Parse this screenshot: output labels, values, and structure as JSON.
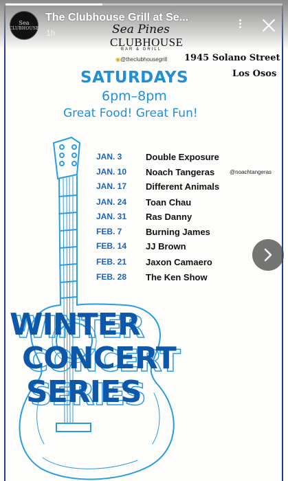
{
  "story": {
    "account_name": "The Clubhouse Grill at Se...",
    "time_ago": "1h",
    "progress": 0.35,
    "avatar_text_top": "Sea",
    "avatar_text": "CLUBHOUSE"
  },
  "flyer": {
    "brand_script": "Sea Pines",
    "brand_name": "CLUBHOUSE",
    "brand_sub": "BAR & GRILL",
    "instagram_handle": "@theclubhousegrill",
    "address_line1": "1945 Solano Street",
    "address_line2": "Los Osos",
    "day": "SATURDAYS",
    "time": "6pm–8pm",
    "tagline": "Great Food! Great Fun!",
    "schedule": [
      {
        "date": "JAN. 3",
        "act": "Double Exposure",
        "tag": ""
      },
      {
        "date": "JAN. 10",
        "act": "Noach Tangeras",
        "tag": "@noachtangeras"
      },
      {
        "date": "JAN. 17",
        "act": "Different Animals",
        "tag": ""
      },
      {
        "date": "JAN. 24",
        "act": "Toan Chau",
        "tag": ""
      },
      {
        "date": "JAN. 31",
        "act": "Ras Danny",
        "tag": ""
      },
      {
        "date": "FEB. 7",
        "act": "Burning James",
        "tag": ""
      },
      {
        "date": "FEB. 14",
        "act": "JJ Brown",
        "tag": ""
      },
      {
        "date": "FEB. 21",
        "act": "Jaxon Camaero",
        "tag": ""
      },
      {
        "date": "FEB. 28",
        "act": "The Ken Show",
        "tag": ""
      }
    ],
    "series_title": [
      "WINTER",
      "CONCERT",
      "SERIES"
    ]
  },
  "colors": {
    "accent_blue": "#1f8fd8",
    "date_blue": "#1f63b8",
    "title_blue": "#0d58a8"
  },
  "icons": {
    "more": "more-vertical-icon",
    "close": "close-icon",
    "next": "chevron-right-icon"
  }
}
